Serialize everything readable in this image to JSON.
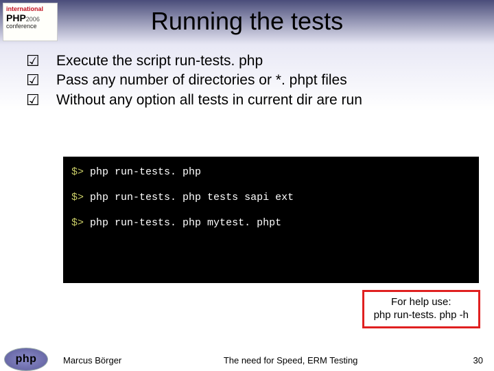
{
  "conference": {
    "top": "international",
    "mid": "PHP",
    "year": "2006",
    "bottom": "conference"
  },
  "title": "Running the tests",
  "bullets": [
    "Execute the script run-tests. php",
    "Pass any number of directories or *. phpt files",
    "Without any option all tests in current dir are run"
  ],
  "term": {
    "prompt": "$>",
    "lines": [
      "php run-tests. php",
      "php run-tests. php tests sapi ext",
      "php run-tests. php mytest. phpt"
    ]
  },
  "help": {
    "l1": "For help use:",
    "l2": "php run-tests. php -h"
  },
  "footer": {
    "author": "Marcus Börger",
    "title": "The need for Speed, ERM Testing",
    "page": "30"
  },
  "logo": "php"
}
